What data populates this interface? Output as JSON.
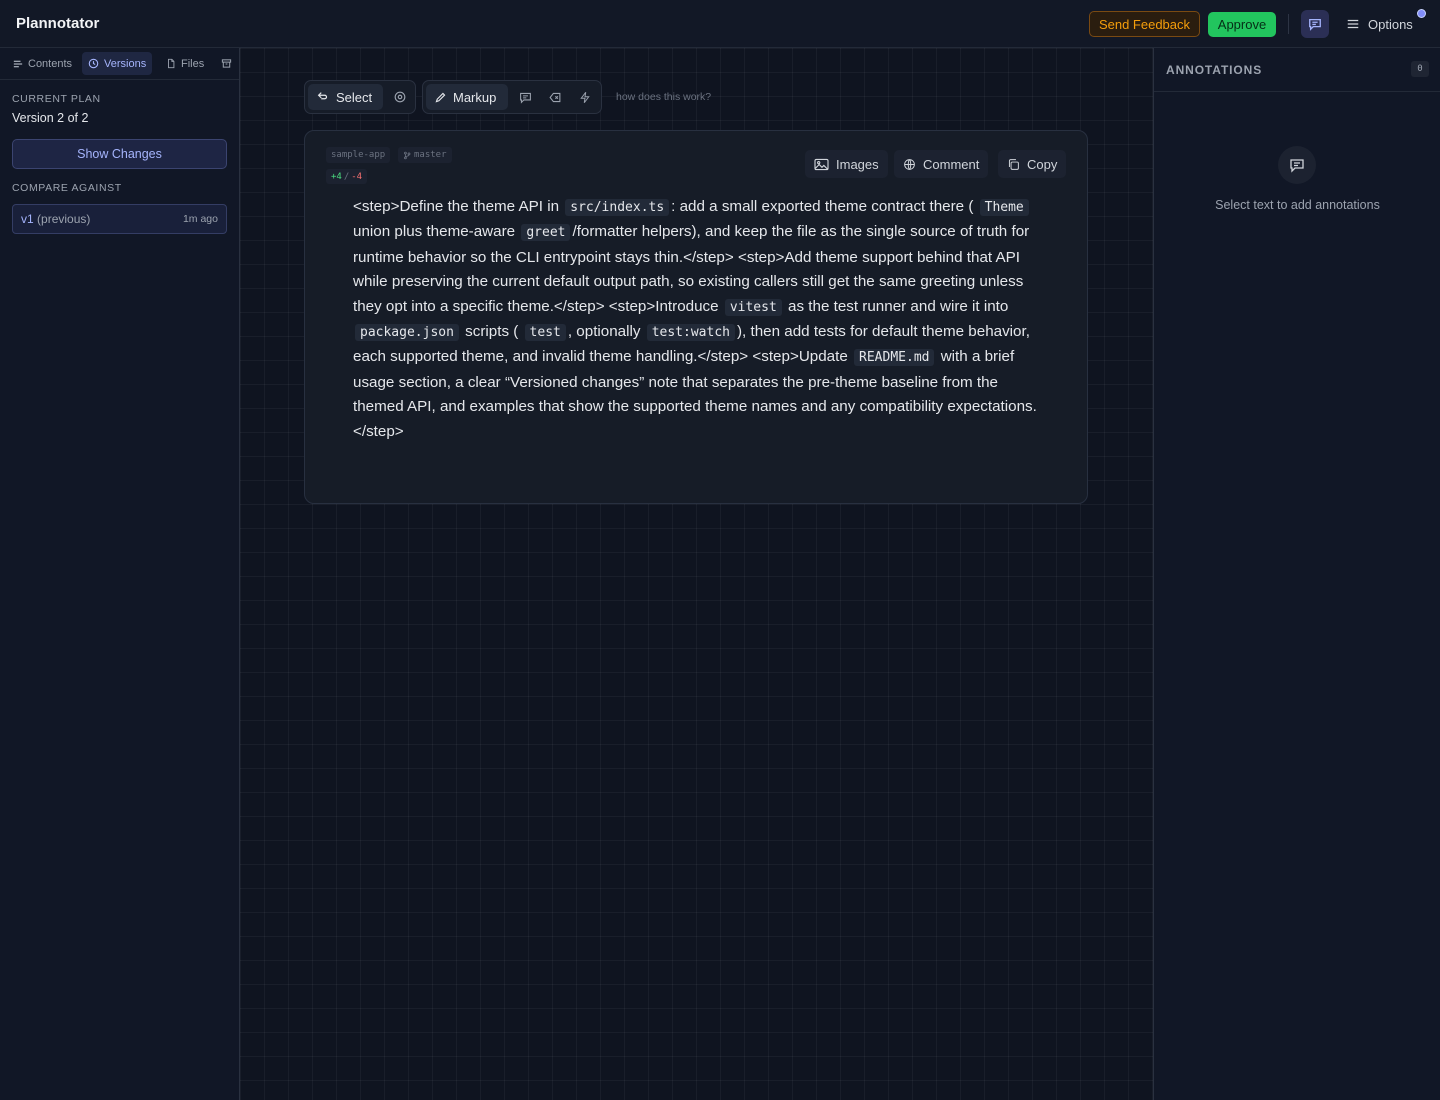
{
  "header": {
    "app_title": "Plannotator",
    "send_feedback": "Send Feedback",
    "approve": "Approve",
    "options": "Options"
  },
  "sidebar": {
    "tabs": [
      {
        "label": "Contents",
        "icon": "list-icon"
      },
      {
        "label": "Versions",
        "icon": "clock-icon",
        "active": true
      },
      {
        "label": "Files",
        "icon": "file-icon"
      },
      {
        "label": "",
        "icon": "archive-icon"
      }
    ],
    "current_plan_label": "CURRENT PLAN",
    "version_text": "Version 2 of 2",
    "show_changes": "Show Changes",
    "compare_label": "COMPARE AGAINST",
    "compare_item": {
      "name": "v1",
      "sub": "(previous)",
      "time": "1m ago"
    }
  },
  "toolbar": {
    "select": "Select",
    "markup": "Markup",
    "help_link": "how does this work?"
  },
  "document": {
    "repo": "sample-app",
    "branch": "master",
    "additions": "+4",
    "diff_sep": "/",
    "deletions": "-4",
    "images_btn": "Images",
    "comment_btn": "Comment",
    "copy_btn": "Copy",
    "p1": "<step>Define the theme API in",
    "c1": "src/index.ts",
    "p2": ": add a small exported theme contract there (",
    "c2": "Theme",
    "p3": "union plus theme-aware",
    "c3": "greet",
    "p4": "/formatter helpers), and keep the file as the single source of truth for runtime behavior so the CLI entrypoint stays thin.</step> <step>Add theme support behind that API while preserving the current default output path, so existing callers still get the same greeting unless they opt into a specific theme.</step> <step>Introduce",
    "c4": "vitest",
    "p5": "as the test runner and wire it into",
    "c5": "package.json",
    "p6": "scripts (",
    "c6": "test",
    "p7": ", optionally",
    "c7": "test:watch",
    "p8": "), then add tests for default theme behavior, each supported theme, and invalid theme handling.</step> <step>Update",
    "c8": "README.md",
    "p9": "with a brief usage section, a clear “Versioned changes” note that separates the pre-theme baseline from the themed API, and examples that show the supported theme names and any compatibility expectations.</step>"
  },
  "annotations": {
    "title": "ANNOTATIONS",
    "count": "0",
    "empty_text": "Select text to add annotations"
  },
  "colors": {
    "approve": "#22c55e",
    "feedback": "#f59e0b",
    "accent": "#a5b4fc"
  }
}
